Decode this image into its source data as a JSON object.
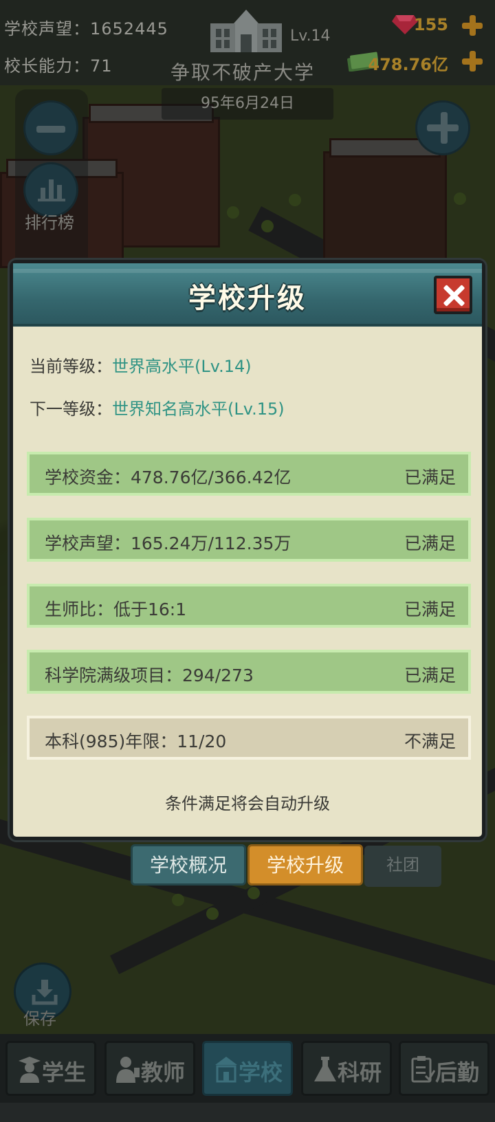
{
  "hud": {
    "reputation_label": "学校声望：",
    "reputation_value": "1652445",
    "ability_label": "校长能力：",
    "ability_value": "71",
    "school_level": "Lv.14",
    "school_name": "争取不破产大学",
    "date": "95年6月24日",
    "gems": "155",
    "money": "478.76亿",
    "gem_color": "#b8263a",
    "money_color": "#4a7a3a",
    "accent_gold": "#a88128"
  },
  "side": {
    "zoom_out_icon": "minus-icon",
    "zoom_in_icon": "plus-icon",
    "ranking_icon": "bar-chart-icon",
    "ranking_label": "排行榜"
  },
  "modal": {
    "title": "学校升级",
    "close_icon": "close-icon",
    "current_level_label": "当前等级：",
    "current_level_value": "世界高水平(Lv.14)",
    "next_level_label": "下一等级：",
    "next_level_value": "世界知名高水平(Lv.15)",
    "requirements": [
      {
        "label": "学校资金：478.76亿/366.42亿",
        "status": "已满足",
        "met": true
      },
      {
        "label": "学校声望：165.24万/112.35万",
        "status": "已满足",
        "met": true
      },
      {
        "label": "生师比：低于16:1",
        "status": "已满足",
        "met": true
      },
      {
        "label": "科学院满级项目：294/273",
        "status": "已满足",
        "met": true
      },
      {
        "label": "本科(985)年限：11/20",
        "status": "不满足",
        "met": false
      }
    ],
    "auto_note": "条件满足将会自动升级",
    "met_color": "#9fc786",
    "unmet_color": "#d6cfb3"
  },
  "sub_tabs": {
    "overview": "学校概况",
    "upgrade": "学校升级",
    "club": "社团"
  },
  "save": {
    "icon": "download-icon",
    "label": "保存"
  },
  "nav": [
    {
      "label": "学生",
      "icon": "student-icon",
      "active": false
    },
    {
      "label": "教师",
      "icon": "teacher-icon",
      "active": false
    },
    {
      "label": "学校",
      "icon": "school-icon",
      "active": true
    },
    {
      "label": "科研",
      "icon": "flask-icon",
      "active": false
    },
    {
      "label": "后勤",
      "icon": "clipboard-icon",
      "active": false
    }
  ]
}
